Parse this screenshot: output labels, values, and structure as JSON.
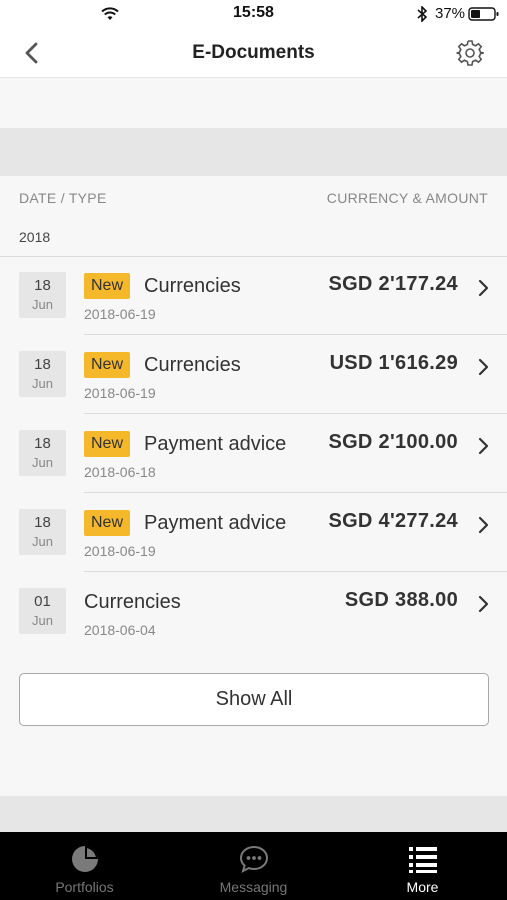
{
  "status_bar": {
    "time": "15:58",
    "battery": "37%"
  },
  "nav": {
    "title": "E-Documents"
  },
  "list_header": {
    "left": "DATE / TYPE",
    "right": "CURRENCY & AMOUNT",
    "year": "2018"
  },
  "documents": [
    {
      "day": "18",
      "month": "Jun",
      "is_new": true,
      "badge": "New",
      "type": "Currencies",
      "date": "2018-06-19",
      "amount": "SGD 2'177.24"
    },
    {
      "day": "18",
      "month": "Jun",
      "is_new": true,
      "badge": "New",
      "type": "Currencies",
      "date": "2018-06-19",
      "amount": "USD 1'616.29"
    },
    {
      "day": "18",
      "month": "Jun",
      "is_new": true,
      "badge": "New",
      "type": "Payment advice",
      "date": "2018-06-18",
      "amount": "SGD 2'100.00"
    },
    {
      "day": "18",
      "month": "Jun",
      "is_new": true,
      "badge": "New",
      "type": "Payment advice",
      "date": "2018-06-19",
      "amount": "SGD 4'277.24"
    },
    {
      "day": "01",
      "month": "Jun",
      "is_new": false,
      "badge": "",
      "type": "Currencies",
      "date": "2018-06-04",
      "amount": "SGD 388.00"
    }
  ],
  "show_all_label": "Show All",
  "tabs": [
    {
      "label": "Portfolios",
      "icon": "pie-chart-icon",
      "active": false
    },
    {
      "label": "Messaging",
      "icon": "chat-bubble-icon",
      "active": false
    },
    {
      "label": "More",
      "icon": "menu-list-icon",
      "active": true
    }
  ],
  "colors": {
    "badge": "#f5b82a",
    "tab_bar": "#000000",
    "band": "#e6e6e6"
  }
}
